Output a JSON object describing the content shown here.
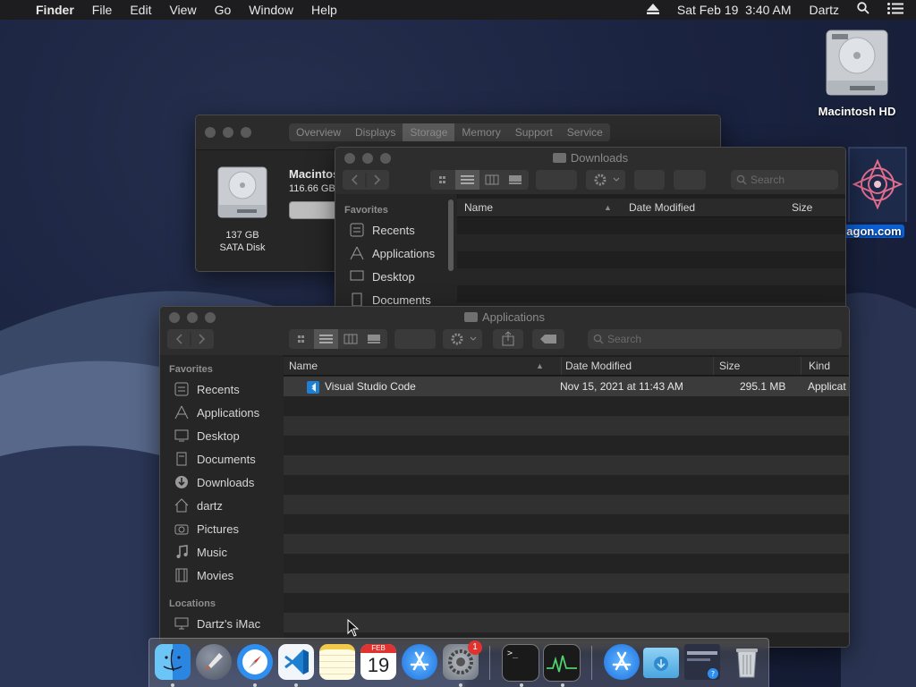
{
  "menubar": {
    "apple_icon": "",
    "app_name": "Finder",
    "menus": [
      "File",
      "Edit",
      "View",
      "Go",
      "Window",
      "Help"
    ],
    "datetime": "Sat Feb 19  3:40 AM",
    "user": "Dartz",
    "icons": [
      "eject-icon",
      "search-icon",
      "list-icon"
    ]
  },
  "desktop": {
    "icons": [
      {
        "label": "Macintosh HD",
        "icon": "hard-drive-icon"
      },
      {
        "label": "agon.com",
        "icon": "mandala-image-icon",
        "selected": true
      }
    ]
  },
  "about_window": {
    "tabs": [
      "Overview",
      "Displays",
      "Storage",
      "Memory",
      "Support",
      "Service"
    ],
    "selected_tab": "Storage",
    "disk_size": "137 GB",
    "disk_type": "SATA Disk",
    "volume_name": "Macintos",
    "volume_capacity": "116.66 GB"
  },
  "downloads_window": {
    "title": "Downloads",
    "search_placeholder": "Search",
    "sidebar_heading": "Favorites",
    "sidebar_items": [
      "Recents",
      "Applications",
      "Desktop",
      "Documents"
    ],
    "columns": [
      "Name",
      "Date Modified",
      "Size"
    ]
  },
  "applications_window": {
    "title": "Applications",
    "search_placeholder": "Search",
    "favorites_heading": "Favorites",
    "favorites": [
      {
        "label": "Recents",
        "icon": "recents-icon"
      },
      {
        "label": "Applications",
        "icon": "applications-icon"
      },
      {
        "label": "Desktop",
        "icon": "desktop-icon"
      },
      {
        "label": "Documents",
        "icon": "documents-icon"
      },
      {
        "label": "Downloads",
        "icon": "downloads-icon"
      },
      {
        "label": "dartz",
        "icon": "home-icon"
      },
      {
        "label": "Pictures",
        "icon": "pictures-icon"
      },
      {
        "label": "Music",
        "icon": "music-icon"
      },
      {
        "label": "Movies",
        "icon": "movies-icon"
      }
    ],
    "locations_heading": "Locations",
    "locations": [
      {
        "label": "Dartz's iMac",
        "icon": "imac-icon"
      }
    ],
    "columns": [
      "Name",
      "Date Modified",
      "Size",
      "Kind"
    ],
    "rows": [
      {
        "name": "Visual Studio Code",
        "date": "Nov 15, 2021 at 11:43 AM",
        "size": "295.1 MB",
        "kind": "Applicat",
        "icon": "vscode-icon"
      }
    ]
  },
  "dock": {
    "apps": [
      {
        "name": "Finder",
        "icon": "finder-icon",
        "running": true
      },
      {
        "name": "Launchpad",
        "icon": "launchpad-icon",
        "running": false
      },
      {
        "name": "Safari",
        "icon": "safari-icon",
        "running": true
      },
      {
        "name": "Visual Studio Code",
        "icon": "vscode-icon",
        "running": true
      },
      {
        "name": "Notes",
        "icon": "notes-icon",
        "running": false
      },
      {
        "name": "Calendar",
        "icon": "calendar-icon",
        "running": false,
        "month": "FEB",
        "day": "19"
      },
      {
        "name": "App Store",
        "icon": "app-store-icon",
        "running": false
      },
      {
        "name": "System Preferences",
        "icon": "system-preferences-icon",
        "running": true,
        "badge": "1"
      },
      {
        "name": "Terminal",
        "icon": "terminal-icon",
        "running": true
      },
      {
        "name": "Activity Monitor",
        "icon": "activity-monitor-icon",
        "running": true
      },
      {
        "name": "App Store Folder",
        "icon": "app-store-folder-icon",
        "running": false
      },
      {
        "name": "Downloads",
        "icon": "downloads-folder-icon",
        "running": false
      },
      {
        "name": "Screen Stack",
        "icon": "screenshot-stack-icon",
        "running": false
      },
      {
        "name": "Trash",
        "icon": "trash-icon",
        "running": false
      }
    ]
  }
}
